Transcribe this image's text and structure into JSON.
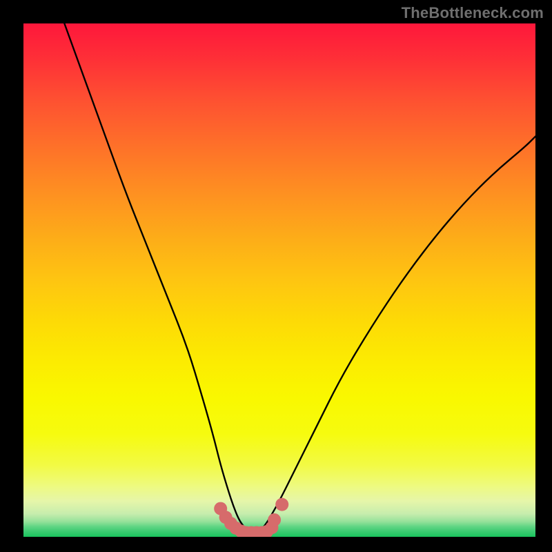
{
  "watermark": "TheBottleneck.com",
  "chart_data": {
    "type": "line",
    "title": "",
    "xlabel": "",
    "ylabel": "",
    "xlim": [
      0,
      100
    ],
    "ylim": [
      0,
      100
    ],
    "grid": false,
    "legend": false,
    "series": [
      {
        "name": "bottleneck-curve",
        "x": [
          8,
          12,
          16,
          20,
          24,
          28,
          32,
          35,
          37,
          38.5,
          40,
          41,
          42,
          43,
          44,
          45,
          46,
          47,
          48,
          50,
          53,
          57,
          62,
          68,
          74,
          80,
          86,
          92,
          98,
          100
        ],
        "y": [
          100,
          89,
          78,
          67,
          57,
          47,
          37,
          27,
          20,
          14,
          9,
          6,
          3.5,
          2,
          1,
          0.7,
          1,
          2,
          3.5,
          7,
          13,
          21,
          31,
          41,
          50,
          58,
          65,
          71,
          76,
          78
        ]
      },
      {
        "name": "highlight-dots",
        "x": [
          38.5,
          39.5,
          40.5,
          41.5,
          42.5,
          43.5,
          44.5,
          45.5,
          46.5,
          47.5,
          48.5,
          49.0,
          50.5
        ],
        "y": [
          5.5,
          3.8,
          2.6,
          1.7,
          1.1,
          0.8,
          0.8,
          0.8,
          0.8,
          1.0,
          1.8,
          3.3,
          6.3
        ]
      }
    ],
    "colors": {
      "curve": "#000000",
      "dots": "#d66b6b",
      "gradient_top": "#fe173b",
      "gradient_bottom": "#1ac45d"
    }
  }
}
